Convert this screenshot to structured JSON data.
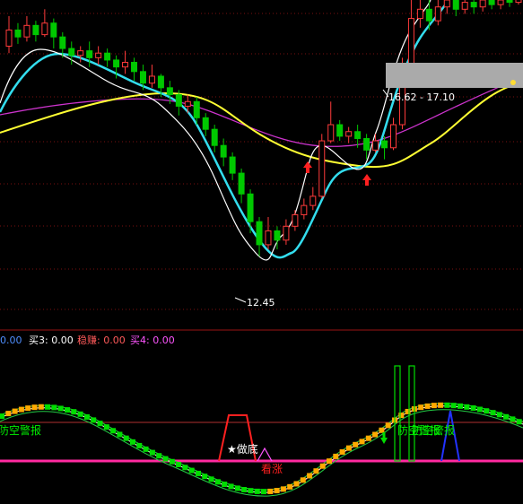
{
  "main_panel": {
    "type": "candlestick",
    "ylim": [
      11.3,
      18.0
    ],
    "grid": true,
    "annotations": {
      "low_label": "12.45",
      "range_label": "16.62 - 17.10"
    },
    "candles": [
      [
        17.0,
        17.35,
        17.65,
        16.85
      ],
      [
        17.35,
        17.2,
        17.5,
        17.05
      ],
      [
        17.2,
        17.45,
        17.65,
        17.1
      ],
      [
        17.45,
        17.25,
        17.55,
        17.1
      ],
      [
        17.25,
        17.5,
        17.8,
        17.2
      ],
      [
        17.5,
        17.2,
        17.6,
        16.95
      ],
      [
        17.2,
        16.95,
        17.3,
        16.75
      ],
      [
        16.95,
        16.8,
        17.1,
        16.6
      ],
      [
        16.8,
        16.9,
        17.0,
        16.65
      ],
      [
        16.9,
        16.75,
        17.1,
        16.55
      ],
      [
        16.75,
        16.85,
        17.0,
        16.6
      ],
      [
        16.85,
        16.7,
        16.95,
        16.55
      ],
      [
        16.7,
        16.55,
        16.8,
        16.3
      ],
      [
        16.55,
        16.65,
        16.9,
        16.4
      ],
      [
        16.65,
        16.45,
        16.75,
        16.25
      ],
      [
        16.45,
        16.2,
        16.6,
        16.05
      ],
      [
        16.2,
        16.35,
        16.6,
        16.1
      ],
      [
        16.35,
        16.1,
        16.4,
        15.9
      ],
      [
        16.1,
        15.95,
        16.25,
        15.75
      ],
      [
        15.95,
        15.7,
        16.05,
        15.5
      ],
      [
        15.7,
        15.8,
        15.95,
        15.55
      ],
      [
        15.8,
        15.45,
        15.9,
        15.3
      ],
      [
        15.45,
        15.2,
        15.55,
        15.05
      ],
      [
        15.2,
        14.85,
        15.3,
        14.7
      ],
      [
        14.85,
        14.6,
        15.0,
        14.4
      ],
      [
        14.6,
        14.25,
        14.7,
        14.1
      ],
      [
        14.25,
        13.8,
        14.35,
        13.6
      ],
      [
        13.8,
        13.2,
        13.9,
        12.95
      ],
      [
        13.2,
        12.7,
        13.3,
        12.45
      ],
      [
        12.7,
        13.0,
        13.3,
        12.6
      ],
      [
        13.0,
        12.8,
        13.1,
        12.6
      ],
      [
        12.8,
        13.1,
        13.25,
        12.7
      ],
      [
        13.1,
        13.35,
        13.45,
        13.0
      ],
      [
        13.35,
        13.55,
        13.7,
        13.25
      ],
      [
        13.55,
        13.75,
        13.95,
        13.45
      ],
      [
        13.75,
        14.95,
        15.1,
        13.7
      ],
      [
        14.95,
        15.3,
        15.8,
        14.9
      ],
      [
        15.3,
        15.05,
        15.4,
        14.95
      ],
      [
        15.05,
        15.15,
        15.25,
        14.9
      ],
      [
        15.15,
        15.0,
        15.3,
        14.8
      ],
      [
        15.0,
        14.75,
        15.1,
        14.55
      ],
      [
        14.75,
        14.95,
        15.1,
        14.7
      ],
      [
        14.95,
        14.8,
        15.05,
        14.55
      ],
      [
        14.8,
        15.3,
        15.45,
        14.75
      ],
      [
        15.3,
        16.6,
        16.75,
        15.2
      ],
      [
        16.6,
        17.6,
        18.05,
        16.5
      ],
      [
        17.6,
        17.8,
        18.05,
        17.4
      ],
      [
        17.8,
        17.55,
        18.05,
        17.35
      ],
      [
        17.55,
        17.85,
        18.05,
        17.45
      ],
      [
        17.85,
        18.0,
        18.05,
        17.7
      ],
      [
        18.0,
        17.8,
        18.05,
        17.65
      ],
      [
        17.8,
        17.95,
        18.05,
        17.7
      ],
      [
        17.95,
        17.85,
        18.05,
        17.7
      ],
      [
        17.85,
        18.0,
        18.05,
        17.75
      ],
      [
        18.0,
        17.9,
        18.05,
        17.8
      ],
      [
        17.9,
        18.0,
        18.05,
        17.8
      ],
      [
        18.0,
        17.95,
        18.05,
        17.85
      ],
      [
        17.95,
        18.02,
        18.05,
        17.9
      ]
    ]
  },
  "indicator_panel": {
    "legend_items": [
      {
        "text": "0.00",
        "color": "#4f8fff"
      },
      {
        "text": "买3: 0.00",
        "color": "#ffffff"
      },
      {
        "text": "稳赚: 0.00",
        "color": "#ff5a5a"
      },
      {
        "text": "买4: 0.00",
        "color": "#ff55ff"
      }
    ],
    "labels": {
      "warn_left": "防空警报",
      "bottom_mark": "★做底",
      "rise": "看涨",
      "warn_right": "防空警报"
    }
  },
  "colors": {
    "background": "#000000",
    "grid": "#7a1010",
    "up": "#ff3b3b",
    "down": "#00c800",
    "ma_white": "#ffffff",
    "ma_cyan": "#33ddee",
    "ma_yellow": "#ffff33",
    "ma_magenta": "#cc33cc",
    "osc_orange": "#ffaa00",
    "osc_green": "#00dd00",
    "hline_magenta": "#ff2aa0"
  }
}
